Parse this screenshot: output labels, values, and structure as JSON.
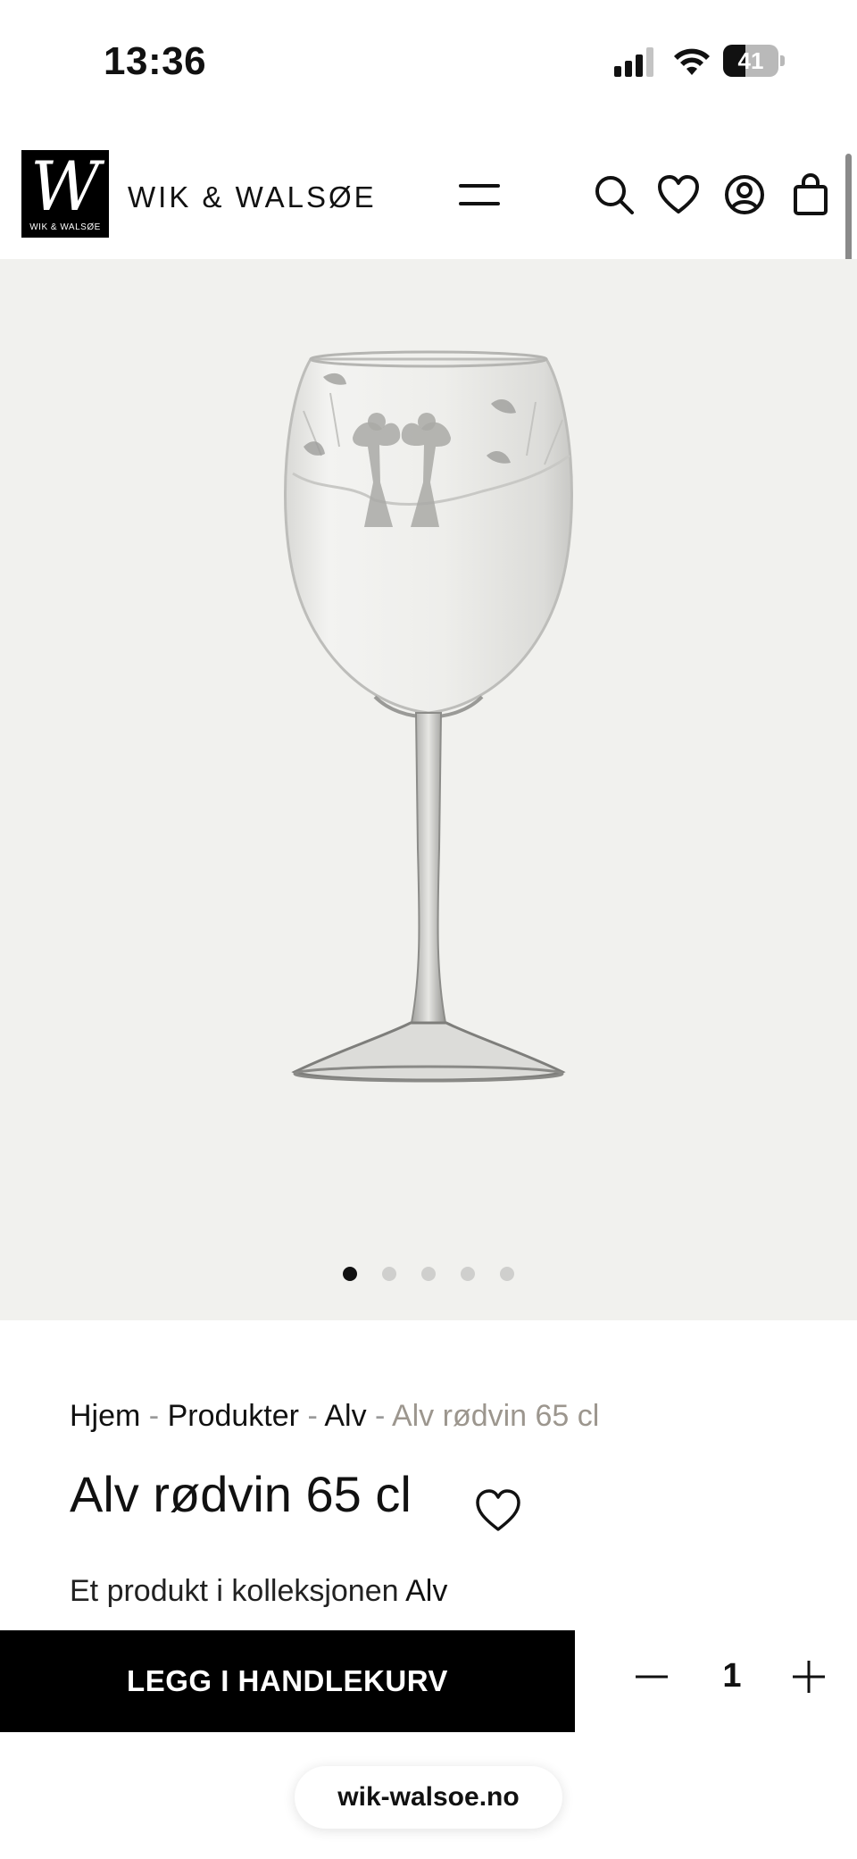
{
  "status_bar": {
    "time": "13:36",
    "battery_level": "41",
    "battery_fraction": 0.41
  },
  "header": {
    "logo_letter": "W",
    "logo_caption": "WIK & WALSØE",
    "brand_name": "WIK & WALSØE",
    "icons": [
      "menu-icon",
      "search-icon",
      "heart-icon",
      "account-icon",
      "cart-icon"
    ]
  },
  "gallery": {
    "slide_count": 5,
    "active_slide": 1,
    "background": "#f1f1ee"
  },
  "breadcrumb": {
    "home": "Hjem",
    "products": "Produkter",
    "collection": "Alv",
    "current": "Alv rødvin 65 cl",
    "separator": "-"
  },
  "product": {
    "title": "Alv rødvin 65 cl",
    "collection_prefix": "Et produkt i kolleksjonen",
    "collection_name": "Alv"
  },
  "cart": {
    "add_label": "LEGG I HANDLEKURV",
    "quantity": "1"
  },
  "browser": {
    "url": "wik-walsoe.no"
  },
  "colors": {
    "accent": "#000000",
    "breadcrumb_current": "#9c968e",
    "gallery_bg": "#f1f1ee"
  }
}
